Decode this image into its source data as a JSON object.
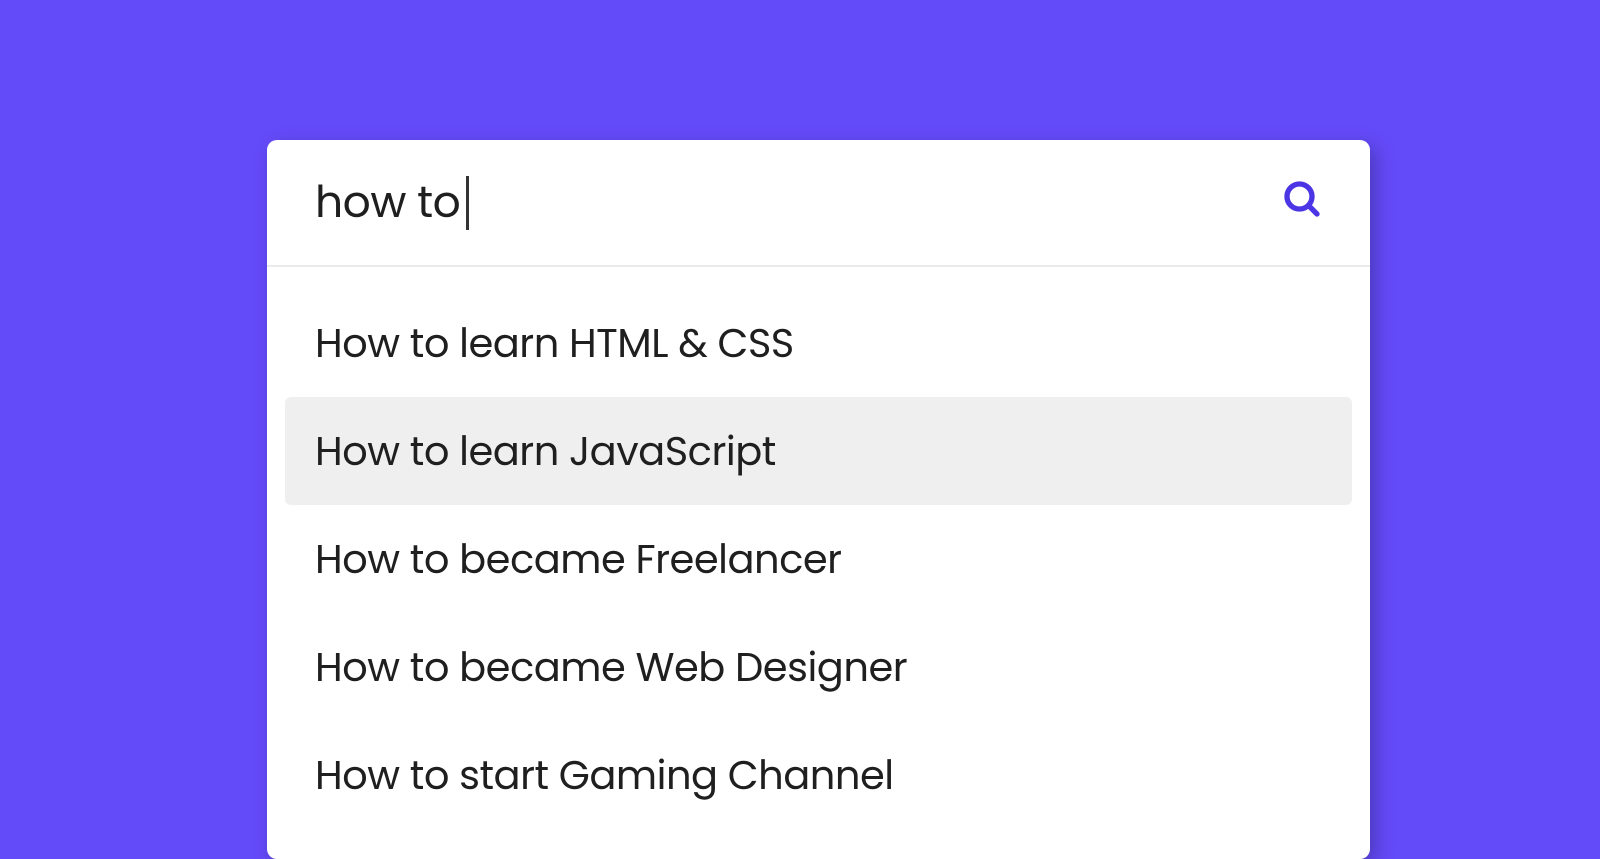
{
  "search": {
    "query": "how to ",
    "icon_name": "search-icon",
    "icon_color": "#4b35e5"
  },
  "suggestions": [
    {
      "label": "How to learn HTML & CSS",
      "highlighted": false
    },
    {
      "label": "How to learn JavaScript",
      "highlighted": true
    },
    {
      "label": "How to became Freelancer",
      "highlighted": false
    },
    {
      "label": "How to became Web Designer",
      "highlighted": false
    },
    {
      "label": "How to start Gaming Channel",
      "highlighted": false
    }
  ]
}
